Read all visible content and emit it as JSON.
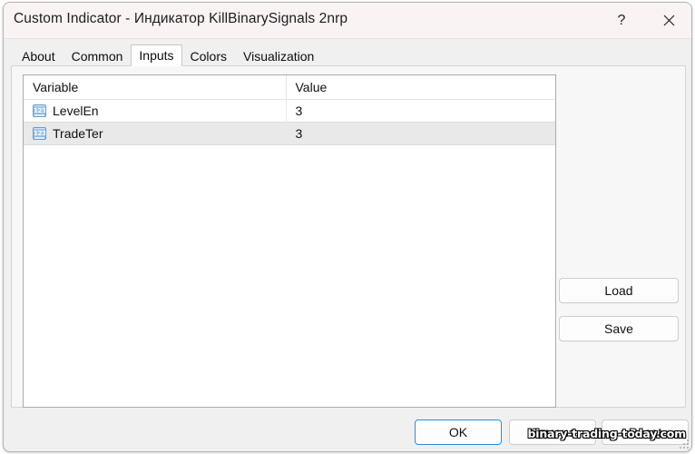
{
  "window": {
    "title": "Custom Indicator - Индикатор KillBinarySignals 2nrp",
    "help_label": "?",
    "close_label": "✕"
  },
  "tabs": [
    {
      "label": "About",
      "active": false
    },
    {
      "label": "Common",
      "active": false
    },
    {
      "label": "Inputs",
      "active": true
    },
    {
      "label": "Colors",
      "active": false
    },
    {
      "label": "Visualization",
      "active": false
    }
  ],
  "inputs_table": {
    "columns": [
      "Variable",
      "Value"
    ],
    "rows": [
      {
        "icon": "numeric-type-icon",
        "variable": "LevelEn",
        "value": "3"
      },
      {
        "icon": "numeric-type-icon",
        "variable": "TradeTer",
        "value": "3"
      }
    ]
  },
  "side_buttons": {
    "load_label": "Load",
    "save_label": "Save"
  },
  "footer_buttons": {
    "ok_label": "OK",
    "cancel_label": "Отмена",
    "reset_label": "Reset"
  },
  "watermark": {
    "text": "binary-trading-today.com"
  },
  "colors": {
    "titlebar_bg": "#f9f3f4",
    "dialog_bg": "#f0f0f0",
    "panel_bg": "#f7f7f7",
    "list_bg": "#ffffff",
    "row_alt_bg": "#e9e9e9",
    "focus_border": "#2e8ad6",
    "icon_blue": "#8cb8dd"
  }
}
